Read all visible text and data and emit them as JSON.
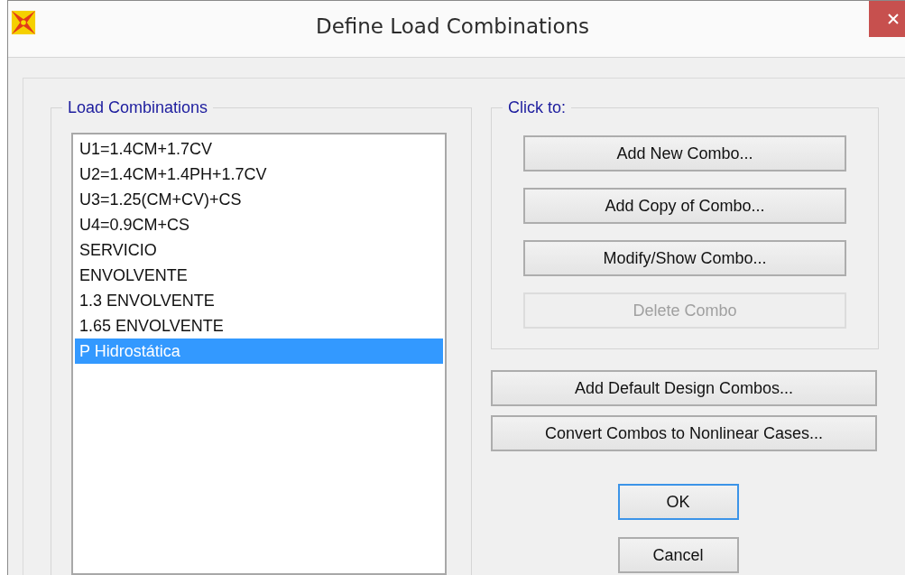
{
  "window": {
    "title": "Define Load Combinations"
  },
  "load_combinations": {
    "label": "Load Combinations",
    "items": [
      {
        "label": "U1=1.4CM+1.7CV",
        "selected": false
      },
      {
        "label": "U2=1.4CM+1.4PH+1.7CV",
        "selected": false
      },
      {
        "label": "U3=1.25(CM+CV)+CS",
        "selected": false
      },
      {
        "label": "U4=0.9CM+CS",
        "selected": false
      },
      {
        "label": "SERVICIO",
        "selected": false
      },
      {
        "label": "ENVOLVENTE",
        "selected": false
      },
      {
        "label": "1.3 ENVOLVENTE",
        "selected": false
      },
      {
        "label": "1.65 ENVOLVENTE",
        "selected": false
      },
      {
        "label": "P Hidrostática",
        "selected": true
      }
    ]
  },
  "click_to": {
    "label": "Click to:",
    "buttons": [
      {
        "label": "Add New Combo...",
        "disabled": false
      },
      {
        "label": "Add Copy of Combo...",
        "disabled": false
      },
      {
        "label": "Modify/Show Combo...",
        "disabled": false
      },
      {
        "label": "Delete Combo",
        "disabled": true
      }
    ]
  },
  "buttons": [
    {
      "label": "Add Default Design Combos..."
    },
    {
      "label": "Convert Combos to Nonlinear Cases..."
    }
  ],
  "dialog_buttons": [
    {
      "label": "OK",
      "default": true
    },
    {
      "label": "Cancel",
      "default": false
    }
  ]
}
